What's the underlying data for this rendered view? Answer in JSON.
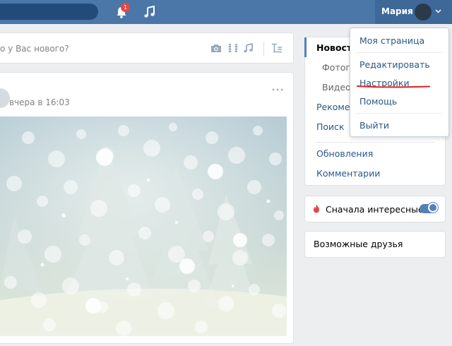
{
  "header": {
    "user_name": "Мария",
    "notification_count": "1",
    "icons": [
      "search-icon",
      "bell-icon",
      "music-icon",
      "chevron-down-icon"
    ]
  },
  "composer": {
    "placeholder_fragment": "о у Вас нового?",
    "icons": [
      "camera-icon",
      "video-icon",
      "music-icon",
      "text-format-icon"
    ]
  },
  "post": {
    "time": "вчера в 16:03"
  },
  "dropdown": {
    "items": [
      {
        "label": "Моя страница"
      },
      {
        "label": "Редактировать"
      },
      {
        "label": "Настройки"
      },
      {
        "label": "Помощь"
      },
      {
        "label": "Выйти"
      }
    ],
    "highlight_color": "#e02020"
  },
  "sidebar": {
    "items": [
      {
        "label": "Новости"
      },
      {
        "label": "Фотогр"
      },
      {
        "label": "Видеоз"
      },
      {
        "label": "Рекомен"
      },
      {
        "label": "Поиск"
      },
      {
        "label": "Обновления"
      },
      {
        "label": "Комментарии"
      }
    ]
  },
  "interesting": {
    "label": "Сначала интересные",
    "enabled": true
  },
  "friends": {
    "label": "Возможные друзья"
  },
  "colors": {
    "header_bg": "#4a76a8",
    "link": "#2a5885",
    "accent": "#5181b8"
  }
}
